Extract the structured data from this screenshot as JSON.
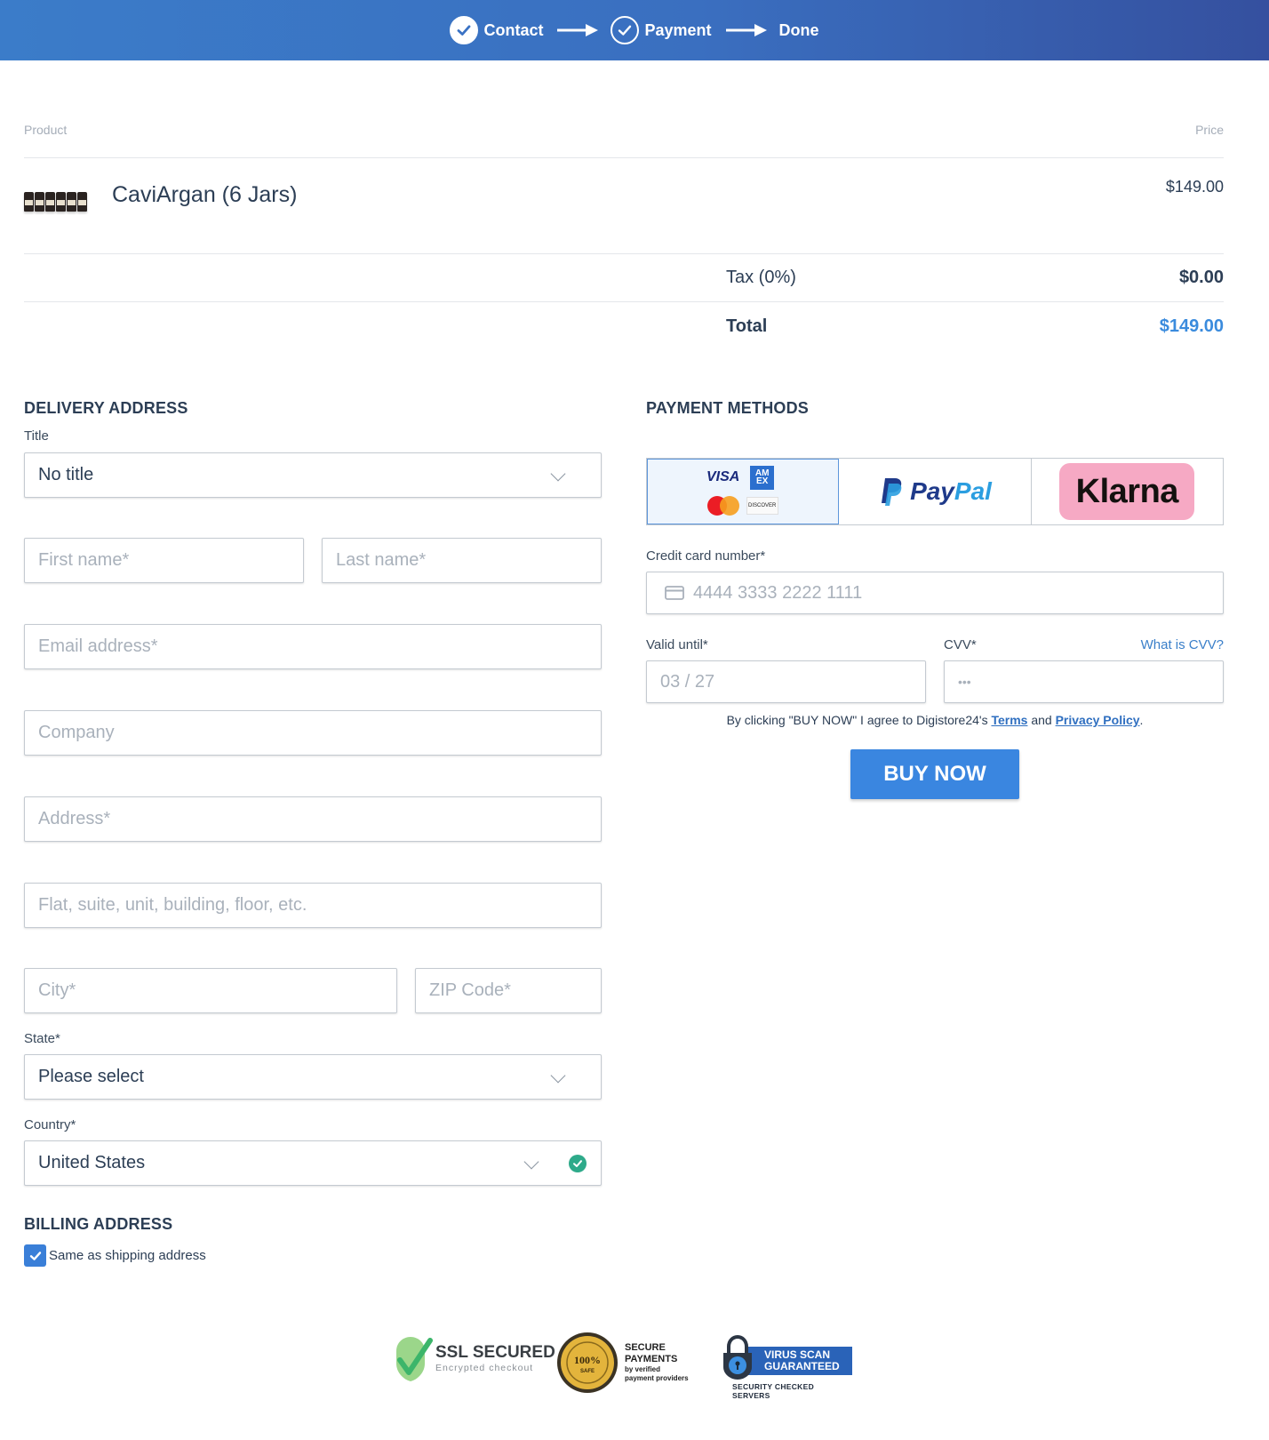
{
  "header": {
    "steps": [
      {
        "label": "Contact",
        "state": "completed"
      },
      {
        "label": "Payment",
        "state": "current"
      },
      {
        "label": "Done",
        "state": "upcoming"
      }
    ]
  },
  "order": {
    "col_product": "Product",
    "col_price": "Price",
    "item_name": "CaviArgan (6 Jars)",
    "item_price": "$149.00",
    "tax_label": "Tax (0%)",
    "tax_value": "$0.00",
    "total_label": "Total",
    "total_value": "$149.00"
  },
  "delivery": {
    "heading": "DELIVERY ADDRESS",
    "title_label": "Title",
    "title_value": "No title",
    "first_name_ph": "First name*",
    "last_name_ph": "Last name*",
    "email_ph": "Email address*",
    "company_ph": "Company",
    "address_ph": "Address*",
    "address2_ph": "Flat, suite, unit, building, floor, etc.",
    "city_ph": "City*",
    "zip_ph": "ZIP Code*",
    "state_label": "State*",
    "state_value": "Please select",
    "country_label": "Country*",
    "country_value": "United States"
  },
  "billing": {
    "heading": "BILLING ADDRESS",
    "same_as_shipping": "Same as shipping address",
    "same_checked": true
  },
  "payment": {
    "heading": "PAYMENT METHODS",
    "methods": [
      {
        "name": "cards",
        "brands": [
          "VISA",
          "AM EX",
          "DISCOVER"
        ],
        "selected": true
      },
      {
        "name": "paypal",
        "logo_a": "Pay",
        "logo_b": "Pal"
      },
      {
        "name": "klarna",
        "logo": "Klarna"
      }
    ],
    "cc_label": "Credit card number*",
    "cc_ph": "4444 3333 2222 1111",
    "valid_label": "Valid until*",
    "valid_ph": "03 / 27",
    "cvv_label": "CVV*",
    "cvv_ph": "•••",
    "cvv_help": "What is CVV?",
    "agree_pre": "By clicking \"BUY NOW\" I agree to Digistore24's ",
    "agree_terms": "Terms",
    "agree_and": " and ",
    "agree_privacy": "Privacy Policy",
    "agree_post": ".",
    "buy_label": "BUY NOW"
  },
  "trust": {
    "ssl_title": "SSL SECURED",
    "ssl_sub": "Encrypted checkout",
    "seal_text": "100%",
    "seal_sub": "SAFE",
    "secure_title_1": "SECURE",
    "secure_title_2": "PAYMENTS",
    "secure_sub_1": "by verified",
    "secure_sub_2": "payment providers",
    "virus_1": "VIRUS SCAN",
    "virus_2": "GUARANTEED",
    "virus_sub": "SECURITY CHECKED SERVERS"
  },
  "colors": {
    "header_start": "#3b7cc9",
    "header_end": "#35509f",
    "accent": "#3a86e0",
    "total": "#3a8bdd",
    "success": "#2eaa8a",
    "klarna": "#f6a9c4"
  }
}
